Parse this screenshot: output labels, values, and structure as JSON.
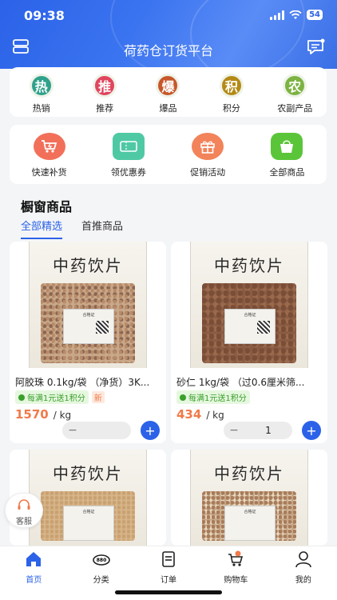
{
  "status_bar": {
    "time": "09:38",
    "battery": "54"
  },
  "header": {
    "title": "荷药仓订货平台",
    "menu_icon": "menu-icon",
    "message_icon": "message-icon"
  },
  "categories": [
    {
      "badge": "热",
      "label": "热销",
      "color": "#2fa18b"
    },
    {
      "badge": "推",
      "label": "推荐",
      "color": "#e0465e"
    },
    {
      "badge": "爆",
      "label": "爆品",
      "color": "#c7572a"
    },
    {
      "badge": "积",
      "label": "积分",
      "color": "#b48a16"
    },
    {
      "badge": "农",
      "label": "农副产品",
      "color": "#7cb342"
    }
  ],
  "services": [
    {
      "label": "快速补货",
      "icon": "quick-restock-cart-icon",
      "color": "#f2705a"
    },
    {
      "label": "领优惠券",
      "icon": "coupon-icon",
      "color": "#4fc9a3"
    },
    {
      "label": "促销活动",
      "icon": "gift-icon",
      "color": "#f2835a"
    },
    {
      "label": "全部商品",
      "icon": "shopping-bag-icon",
      "color": "#5bc53a"
    }
  ],
  "section": {
    "title": "橱窗商品",
    "tabs": [
      "全部精选",
      "首推商品"
    ],
    "active_tab": 0
  },
  "product_image_text": {
    "banner": "中药饮片",
    "cert": "合格证"
  },
  "products": [
    {
      "title": "阿胶珠 0.1kg/袋 （净货）3K...",
      "promo": "每满1元送1积分",
      "new_tag": "新",
      "price": "1570",
      "unit": "/ kg",
      "qty": ""
    },
    {
      "title": "砂仁 1kg/袋 （过0.6厘米筛...",
      "promo": "每满1元送1积分",
      "price": "434",
      "unit": "/ kg",
      "qty": "1"
    }
  ],
  "customer_service": {
    "label": "客服"
  },
  "tabbar": [
    {
      "label": "首页",
      "icon": "home-icon",
      "active": true
    },
    {
      "label": "分类",
      "icon": "category-icon",
      "active": false
    },
    {
      "label": "订单",
      "icon": "order-icon",
      "active": false
    },
    {
      "label": "购物车",
      "icon": "cart-icon",
      "active": false,
      "badge": ""
    },
    {
      "label": "我的",
      "icon": "profile-icon",
      "active": false
    }
  ]
}
